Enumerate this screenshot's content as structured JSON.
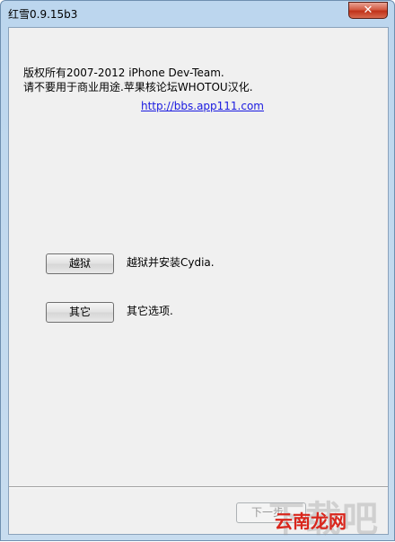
{
  "window": {
    "title": "红雪0.9.15b3",
    "close_glyph": "✕"
  },
  "main": {
    "copyright_line1": "版权所有2007-2012 iPhone Dev-Team.",
    "copyright_line2": "请不要用于商业用途.苹果核论坛WHOTOU汉化.",
    "link": "http://bbs.app111.com"
  },
  "actions": {
    "jailbreak_label": "越狱",
    "jailbreak_desc": "越狱并安装Cydia.",
    "other_label": "其它",
    "other_desc": "其它选项."
  },
  "footer": {
    "next_label": "下一步"
  },
  "watermark": {
    "big": "下载吧",
    "logo": "云南龙网"
  }
}
